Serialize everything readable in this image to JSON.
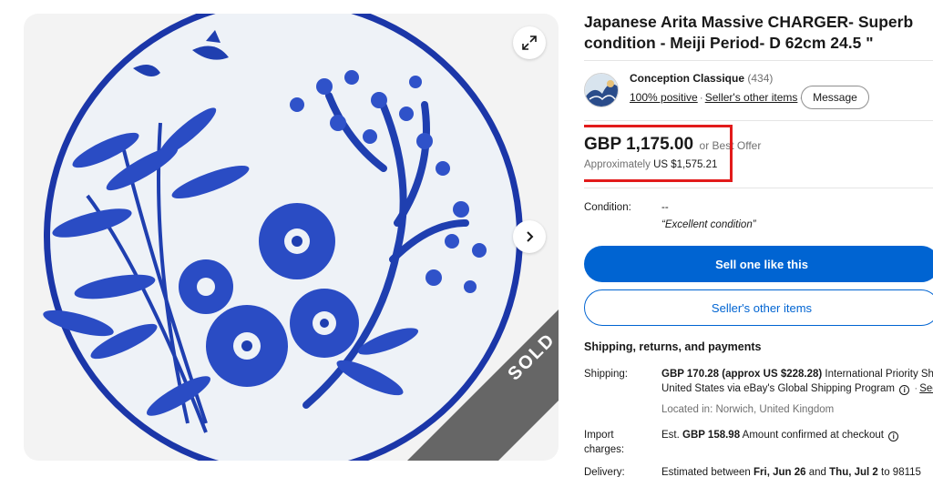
{
  "listing": {
    "title": "Japanese Arita Massive CHARGER- Superb condition - Meiji Period- D 62cm 24.5 \"",
    "sold_badge": "SOLD"
  },
  "seller": {
    "name": "Conception Classique",
    "feedback_count": "(434)",
    "positive": "100% positive",
    "other_items_link": "Seller's other items",
    "message_button": "Message"
  },
  "price": {
    "main": "GBP 1,175.00",
    "offer": "or Best Offer",
    "approx_prefix": "Approximately",
    "approx_value": "US $1,575.21"
  },
  "condition": {
    "label": "Condition:",
    "value": "--",
    "note": "“Excellent condition”"
  },
  "actions": {
    "sell_one": "Sell one like this",
    "seller_items": "Seller's other items"
  },
  "shipping": {
    "heading": "Shipping, returns, and payments",
    "shipping_label": "Shipping:",
    "shipping_cost": "GBP 170.28 (approx US $228.28)",
    "shipping_service": "International Priority Ship",
    "shipping_line2": "United States via eBay's Global Shipping Program",
    "see_link": "See",
    "location": "Located in: Norwich, United Kingdom",
    "import_label_1": "Import",
    "import_label_2": "charges:",
    "import_value_prefix": "Est.",
    "import_value_amount": "GBP 158.98",
    "import_value_suffix": "Amount confirmed at checkout",
    "delivery_label": "Delivery:",
    "delivery_prefix": "Estimated between",
    "delivery_start": "Fri, Jun 26",
    "delivery_and": "and",
    "delivery_end": "Thu, Jul 2",
    "delivery_to": "to 98115"
  },
  "icons": {
    "expand": "expand-icon",
    "next": "chevron-right-icon",
    "info": "info-icon"
  },
  "colors": {
    "primary": "#0064d2",
    "highlight": "#e21b1b",
    "plate_blue": "#1f3fb0"
  }
}
